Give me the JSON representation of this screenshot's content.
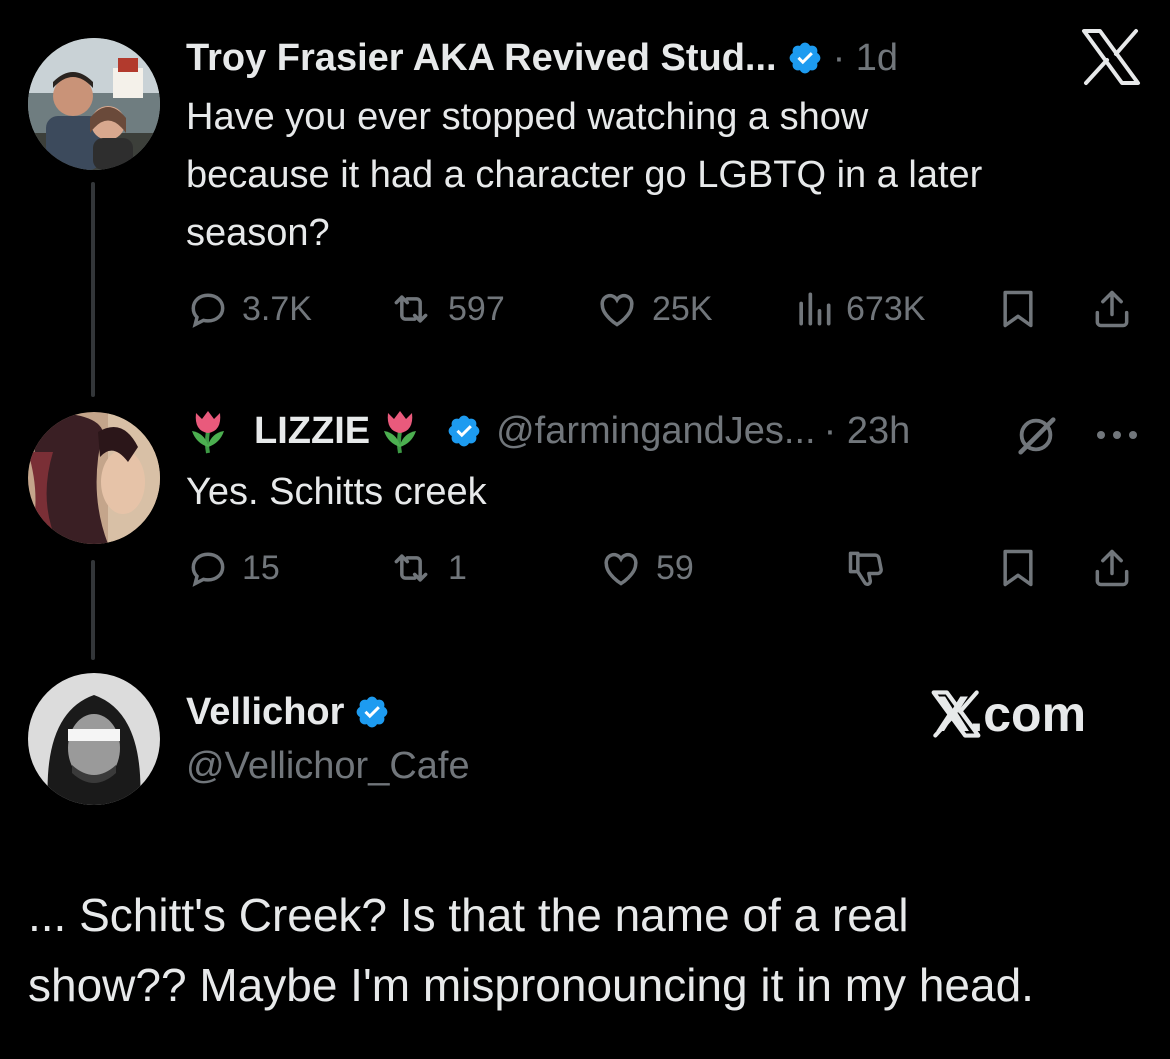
{
  "tweet1": {
    "display_name": "Troy Frasier AKA Revived Stud...",
    "time": "· 1d",
    "text_lines": [
      "Have you ever stopped watching a show",
      "because it had a character go LGBTQ in a later",
      "season?"
    ],
    "replies": "3.7K",
    "retweets": "597",
    "likes": "25K",
    "views": "673K"
  },
  "tweet2": {
    "display_name": "LIZZIE",
    "handle": "@farmingandJes...",
    "time": "· 23h",
    "text": "Yes. Schitts creek",
    "replies": "15",
    "retweets": "1",
    "likes": "59"
  },
  "tweet3": {
    "display_name": "Vellichor",
    "handle": "@Vellichor_Cafe",
    "brand": "X.com",
    "text_lines": [
      "... Schitt's Creek? Is that the name of a real",
      "show?? Maybe I'm mispronouncing it in my head."
    ]
  },
  "colors": {
    "background": "#000000",
    "text": "#e7e9ea",
    "muted": "#71767b",
    "verified_blue": "#1d9bf0",
    "thread_line": "#333639"
  },
  "icons": [
    "x-logo",
    "verified-badge",
    "reply-icon",
    "retweet-icon",
    "heart-icon",
    "views-icon",
    "bookmark-icon",
    "share-icon",
    "grok-icon",
    "more-icon",
    "dislike-icon",
    "tulip-emoji"
  ]
}
